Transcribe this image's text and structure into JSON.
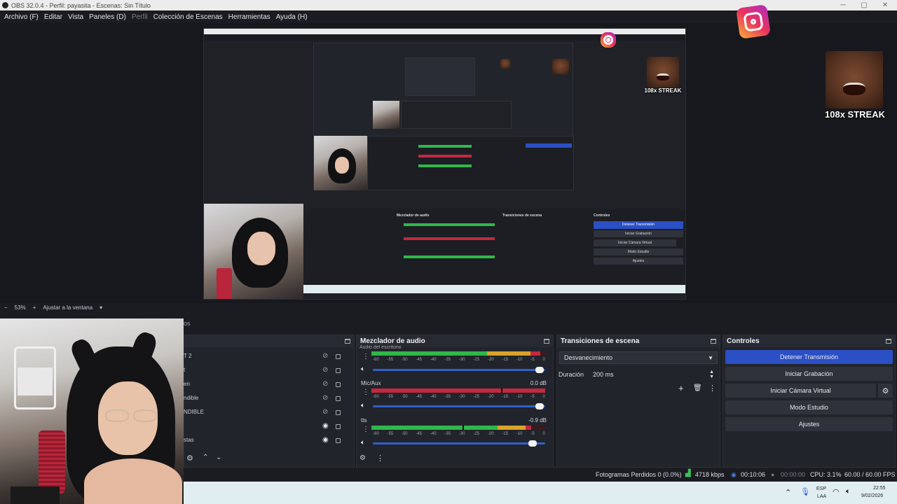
{
  "titlebar": {
    "title": "OBS 32.0.4 - Perfil: payasita - Escenas: Sin Título"
  },
  "menu": {
    "archivo": "Archivo (F)",
    "editar": "Editar",
    "vista": "Vista",
    "paneles": "Paneles (D)",
    "perfil": "Perfil",
    "coleccion": "Colección de Escenas",
    "herramientas": "Herramientas",
    "ayuda": "Ayuda (H)"
  },
  "overlay": {
    "streak": "108x STREAK"
  },
  "zoom": {
    "minus": "−",
    "value": "53%",
    "plus": "+",
    "fit": "Ajustar a la ventana",
    "chevron": "▾"
  },
  "sources": {
    "tab_partial": "os",
    "items": [
      {
        "label": "T 2",
        "visible": false
      },
      {
        "label": "t",
        "visible": false
      },
      {
        "label": "en",
        "visible": false
      },
      {
        "label": "ndible",
        "visible": false
      },
      {
        "label": "NDIBLE",
        "visible": false
      },
      {
        "label": "",
        "visible": true
      },
      {
        "label": "stas",
        "visible": true
      }
    ]
  },
  "mixer": {
    "title": "Mezclador de audio",
    "partial_top": "Audio del escritorio",
    "scale": [
      "-60",
      "-55",
      "-50",
      "-45",
      "-40",
      "-35",
      "-30",
      "-25",
      "-20",
      "-15",
      "-10",
      "-5",
      "0"
    ],
    "channels": [
      {
        "name": "",
        "db": ""
      },
      {
        "name": "Mic/Aux",
        "db": "0.0 dB"
      },
      {
        "name": "tts",
        "db": "-0.9 dB"
      }
    ]
  },
  "transitions": {
    "title": "Transiciones de escena",
    "selected": "Desvanecimiento",
    "duration_label": "Duración",
    "duration_value": "200 ms"
  },
  "controls": {
    "title": "Controles",
    "stop_stream": "Detener Transmisión",
    "start_recording": "Iniciar Grabación",
    "start_virtual_cam": "Iniciar Cámara Virtual",
    "studio_mode": "Modo Estudio",
    "settings": "Ajustes"
  },
  "status": {
    "dropped_frames": "Fotogramas Perdidos 0 (0.0%)",
    "bitrate": "4718 kbps",
    "stream_time": "00:10:06",
    "rec_time": "00:00:00",
    "cpu": "CPU: 3.1%",
    "fps": "60.00 / 60.00 FPS"
  },
  "taskbar": {
    "lang_top": "ESP",
    "lang_bottom": "LAA",
    "time": "22:55",
    "date": "9/02/2026"
  },
  "colors": {
    "accent": "#2b4fc4",
    "meter_green": "#2fb84a",
    "meter_yellow": "#d9a32a",
    "meter_red": "#c4283f"
  }
}
